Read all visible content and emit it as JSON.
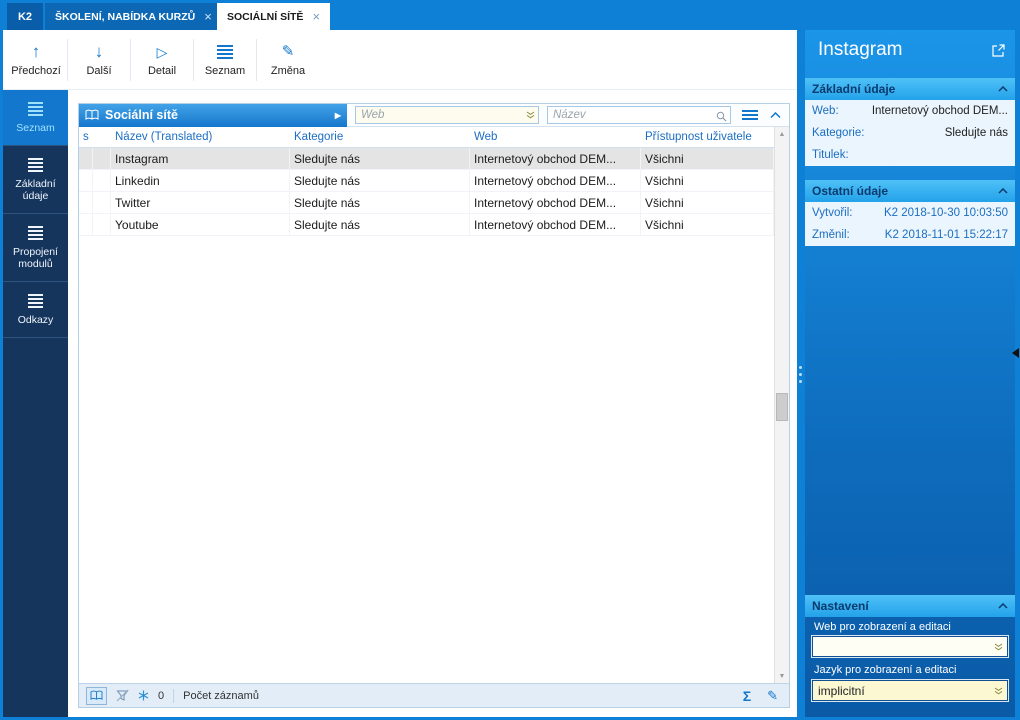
{
  "tabbar": {
    "app_button": "K2",
    "close_glyph": "×",
    "tabs": [
      {
        "label": "ŠKOLENÍ, NABÍDKA KURZŮ"
      },
      {
        "label": "SOCIÁLNÍ SÍTĚ"
      }
    ]
  },
  "toolbar": {
    "buttons": [
      {
        "label": "Předchozí"
      },
      {
        "label": "Další"
      },
      {
        "label": "Detail"
      },
      {
        "label": "Seznam"
      },
      {
        "label": "Změna"
      }
    ],
    "menu": {
      "label": "Menu"
    }
  },
  "sidebar": {
    "items": [
      {
        "label": "Seznam",
        "active": true
      },
      {
        "label": "Základní údaje",
        "active": false
      },
      {
        "label": "Propojení modulů",
        "active": false
      },
      {
        "label": "Odkazy",
        "active": false
      }
    ]
  },
  "browse": {
    "title": "Sociální sítě",
    "filters": {
      "web_placeholder": "Web",
      "nazev_placeholder": "Název"
    },
    "columns": {
      "s": "s",
      "nazev": "Název (Translated)",
      "kategorie": "Kategorie",
      "web": "Web",
      "pristupnost": "Přístupnost uživatele"
    },
    "rows": [
      {
        "nazev": "Instagram",
        "kategorie": "Sledujte nás",
        "web": "Internetový obchod DEM...",
        "pristupnost": "Všichni",
        "selected": true
      },
      {
        "nazev": "Linkedin",
        "kategorie": "Sledujte nás",
        "web": "Internetový obchod DEM...",
        "pristupnost": "Všichni",
        "selected": false
      },
      {
        "nazev": "Twitter",
        "kategorie": "Sledujte nás",
        "web": "Internetový obchod DEM...",
        "pristupnost": "Všichni",
        "selected": false
      },
      {
        "nazev": "Youtube",
        "kategorie": "Sledujte nás",
        "web": "Internetový obchod DEM...",
        "pristupnost": "Všichni",
        "selected": false
      }
    ],
    "statusbar": {
      "count": "0",
      "records_label": "Počet záznamů"
    }
  },
  "detail_panel": {
    "title": "Instagram",
    "sections": [
      {
        "title": "Základní údaje",
        "fields": [
          {
            "label": "Web:",
            "value": "Internetový obchod DEM..."
          },
          {
            "label": "Kategorie:",
            "value": "Sledujte nás"
          },
          {
            "label": "Titulek:",
            "value": ""
          }
        ]
      },
      {
        "title": "Ostatní údaje",
        "fields": [
          {
            "label": "Vytvořil:",
            "value": "K2 2018-10-30 10:03:50"
          },
          {
            "label": "Změnil:",
            "value": "K2 2018-11-01 15:22:17"
          }
        ]
      }
    ],
    "settings": {
      "title": "Nastavení",
      "web_label": "Web pro zobrazení a editaci",
      "web_value": "",
      "lang_label": "Jazyk pro zobrazení a editaci",
      "lang_value": "implicitní"
    }
  },
  "colors": {
    "frame_blue": "#0e81d6",
    "sidebar_navy": "#16355d",
    "accent_blue": "#1277cc",
    "section_header_cyan": "#35b2f2",
    "selected_row_gray": "#e4e4e4"
  }
}
